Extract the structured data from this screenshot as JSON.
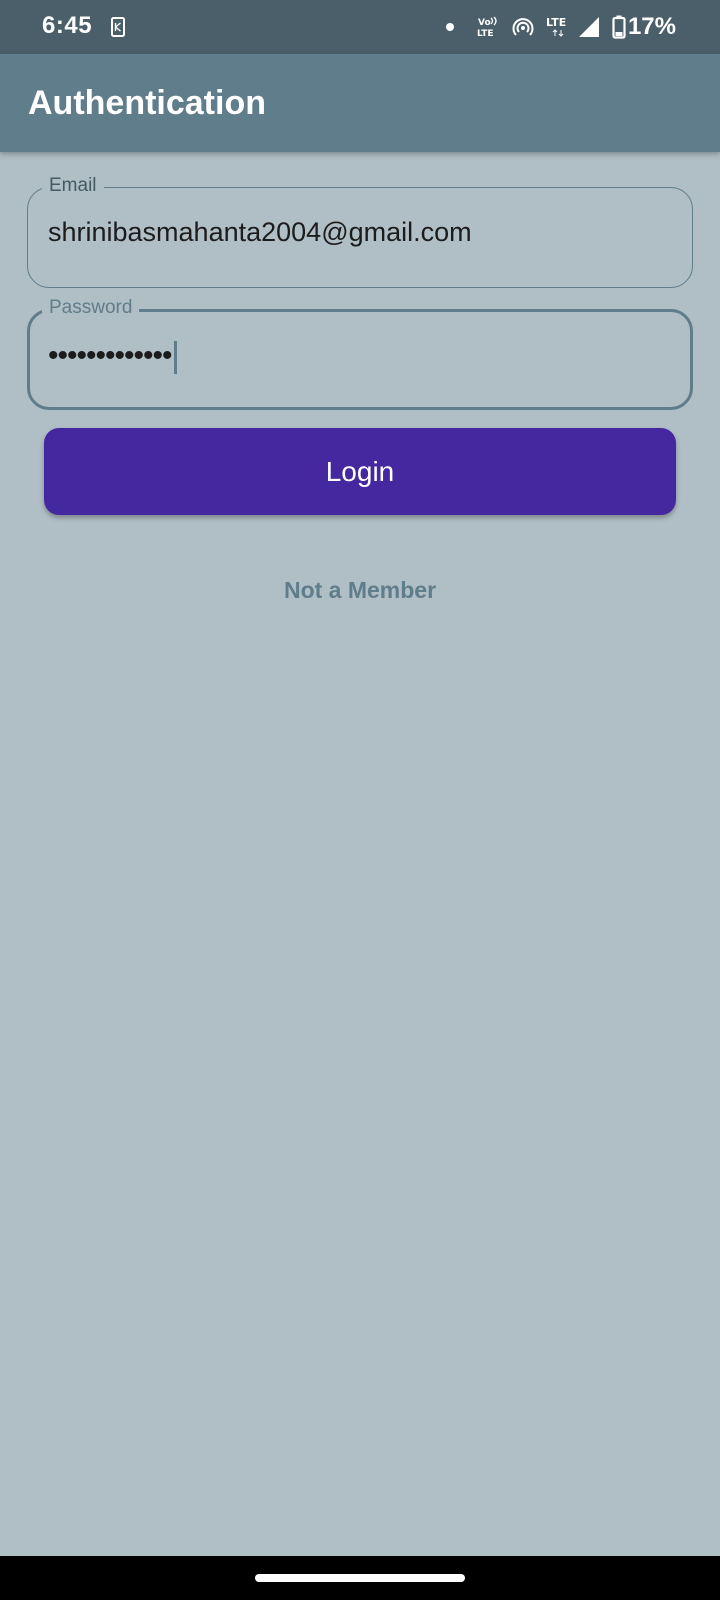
{
  "status_bar": {
    "time": "6:45",
    "battery_percent": "17%",
    "notification_icon": "keyboard-notification-icon",
    "icons": [
      "dot-icon",
      "volte-icon",
      "hotspot-icon",
      "lte-icon",
      "signal-icon",
      "battery-icon"
    ],
    "volte_text_top": "Vo",
    "volte_text_bottom": "LTE",
    "lte_text": "LTE"
  },
  "app_bar": {
    "title": "Authentication"
  },
  "form": {
    "email": {
      "label": "Email",
      "value": "shrinibasmahanta2004@gmail.com"
    },
    "password": {
      "label": "Password",
      "masked_value": "•••••••••••••",
      "focused": true
    },
    "login_label": "Login",
    "signup_link": "Not a Member"
  },
  "colors": {
    "background": "#b0bec5",
    "status_bar": "#4a5f6a",
    "app_bar": "#607d8b",
    "button": "#4527a0",
    "link": "#607d8b",
    "outline": "#607d8b",
    "nav_bar": "#000000"
  }
}
